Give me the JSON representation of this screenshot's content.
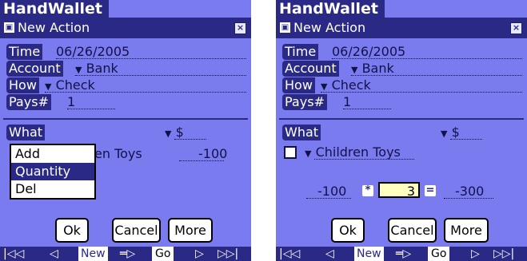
{
  "app_title": "HandWallet",
  "window_title": "New Action",
  "close_symbol": "⊠",
  "fields": {
    "time_label": "Time",
    "time_value": "06/26/2005",
    "account_label": "Account",
    "account_value": "Bank",
    "how_label": "How",
    "how_value": "Check",
    "pays_label": "Pays#",
    "pays_value": "1"
  },
  "what_label": "What",
  "currency_value": "$",
  "item": {
    "category": "Children Toys",
    "category_partial": "en Toys",
    "amount": "-100"
  },
  "menu": [
    "Add",
    "Quantity",
    "Del"
  ],
  "menu_selected_index": 1,
  "calc": {
    "unit_price": "-100",
    "multiply": "*",
    "quantity": "3",
    "equals": "=",
    "total": "-300"
  },
  "buttons": {
    "ok": "Ok",
    "cancel": "Cancel",
    "more": "More"
  },
  "bottom_bar": {
    "first": "|◁◁",
    "prev": "◁",
    "new": "New",
    "link": "═▷",
    "go": "Go",
    "next": "▷",
    "last": "▷▷|"
  },
  "icons": {
    "gear_box": "⊠"
  }
}
